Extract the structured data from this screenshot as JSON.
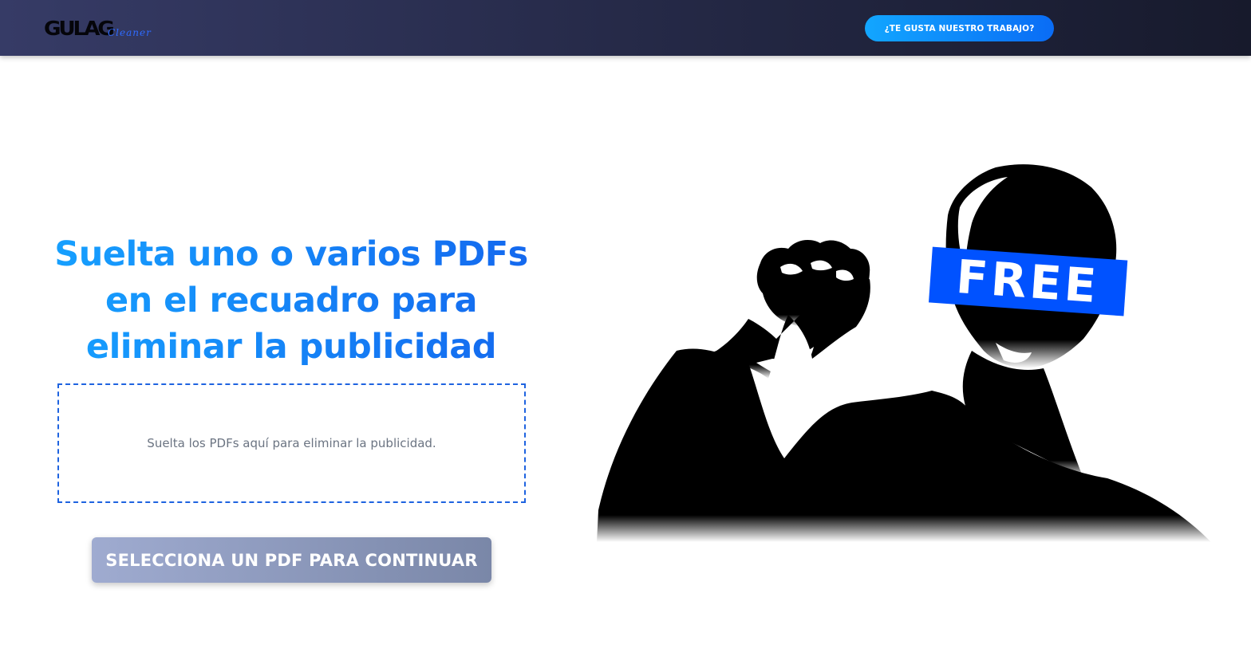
{
  "header": {
    "logo_main": "GULAG",
    "logo_sub": "Cleaner",
    "cta_label": "¿TE GUSTA NUESTRO TRABAJO?"
  },
  "main": {
    "headline_lines": [
      "Suelta uno o varios PDFs",
      "en el recuadro para",
      "eliminar la publicidad"
    ],
    "dropzone_text": "Suelta los PDFs aquí para eliminar la publicidad.",
    "continue_label": "SELECCIONA UN PDF PARA CONTINUAR"
  },
  "illustration": {
    "banner_text": "FREE",
    "icon": "raised-fist-portrait-illustration"
  },
  "colors": {
    "nav_bg": "#242845",
    "accent_blue": "#0a6cf5",
    "headline_blue": "#16a2ff",
    "button_disabled": "#8f9bbf",
    "banner_blue": "#0052ff"
  }
}
